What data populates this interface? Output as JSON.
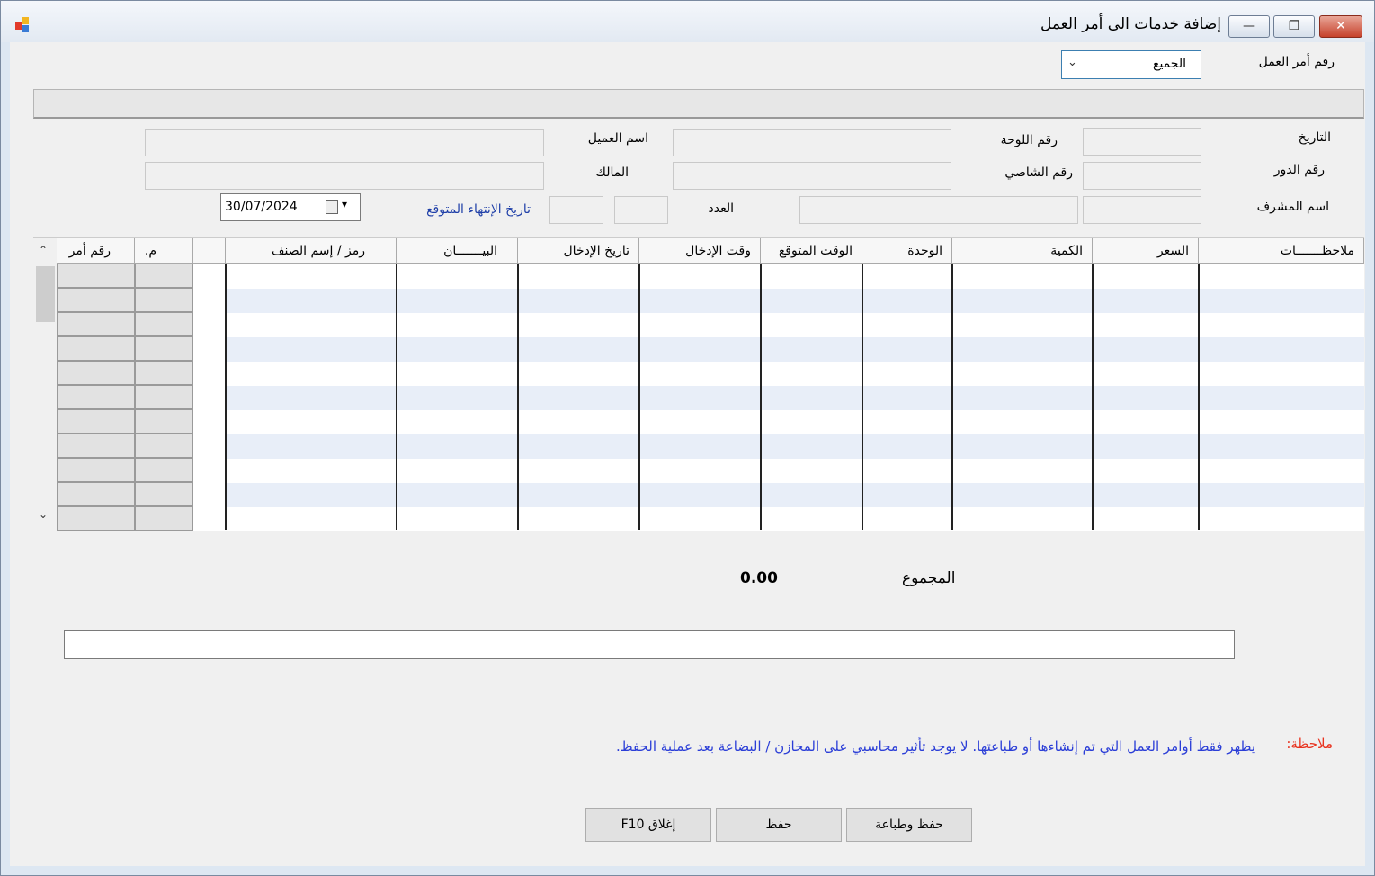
{
  "window": {
    "title": "إضافة خدمات الى أمر العمل",
    "minimize": "—",
    "restore": "❐",
    "close": "✕"
  },
  "order": {
    "label": "رقم أمر العمل",
    "selected": "الجميع"
  },
  "form": {
    "date_label": "التاريخ",
    "plate_label": "رقم اللوحة",
    "customer_label": "اسم العميل",
    "turn_label": "رقم الدور",
    "chassis_label": "رقم الشاصي",
    "owner_label": "المالك",
    "supervisor_label": "اسم المشرف",
    "count_label": "العدد",
    "expected_end_label": "تاريخ الإنتهاء المتوقع",
    "expected_end_value": "30/07/2024"
  },
  "grid": {
    "columns": [
      "ملاحظـــــــات",
      "السعر",
      "الكمية",
      "الوحدة",
      "الوقت المتوقع",
      "وقت الإدخال",
      "تاريخ الإدخال",
      "البيـــــــان",
      "رمز / إسم الصنف",
      "",
      "م.",
      "رقم أمر"
    ]
  },
  "total": {
    "label": "المجموع",
    "value": "0.00"
  },
  "note": {
    "label": "ملاحظة:",
    "text": "يظهر فقط أوامر العمل التي تم إنشاءها أو طباعتها. لا يوجد تأثير محاسبي على المخازن / البضاعة بعد عملية الحفظ."
  },
  "buttons": {
    "save_print": "حفظ وطباعة",
    "save": "حفظ",
    "close": "إغلاق F10"
  },
  "colors": {
    "note_label": "#e8331f",
    "note_text": "#2b3ed7",
    "link_label": "#1f3fa8"
  }
}
